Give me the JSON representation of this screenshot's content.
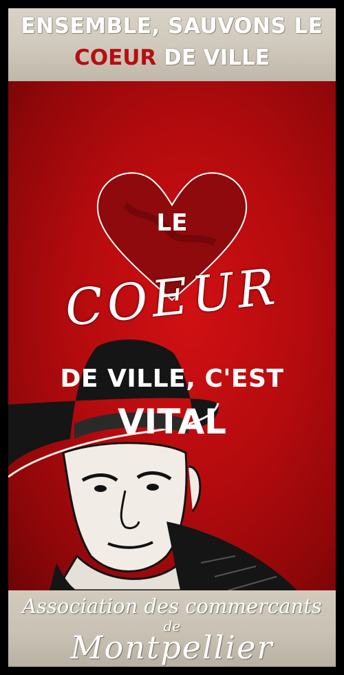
{
  "banner_top": {
    "line1": "ENSEMBLE, SAUVONS LE",
    "line2_accent": "COEUR",
    "line2_rest": " DE VILLE"
  },
  "headline": {
    "le": "LE",
    "coeur": "COEUR",
    "ville": "DE VILLE, C'EST",
    "vital": "VITAL"
  },
  "footer": {
    "association": "Association des commercants",
    "de": "de",
    "city": "Montpellier"
  },
  "colors": {
    "red": "#b5090c",
    "banner": "#d2cbbd",
    "accent": "#b60e10"
  }
}
